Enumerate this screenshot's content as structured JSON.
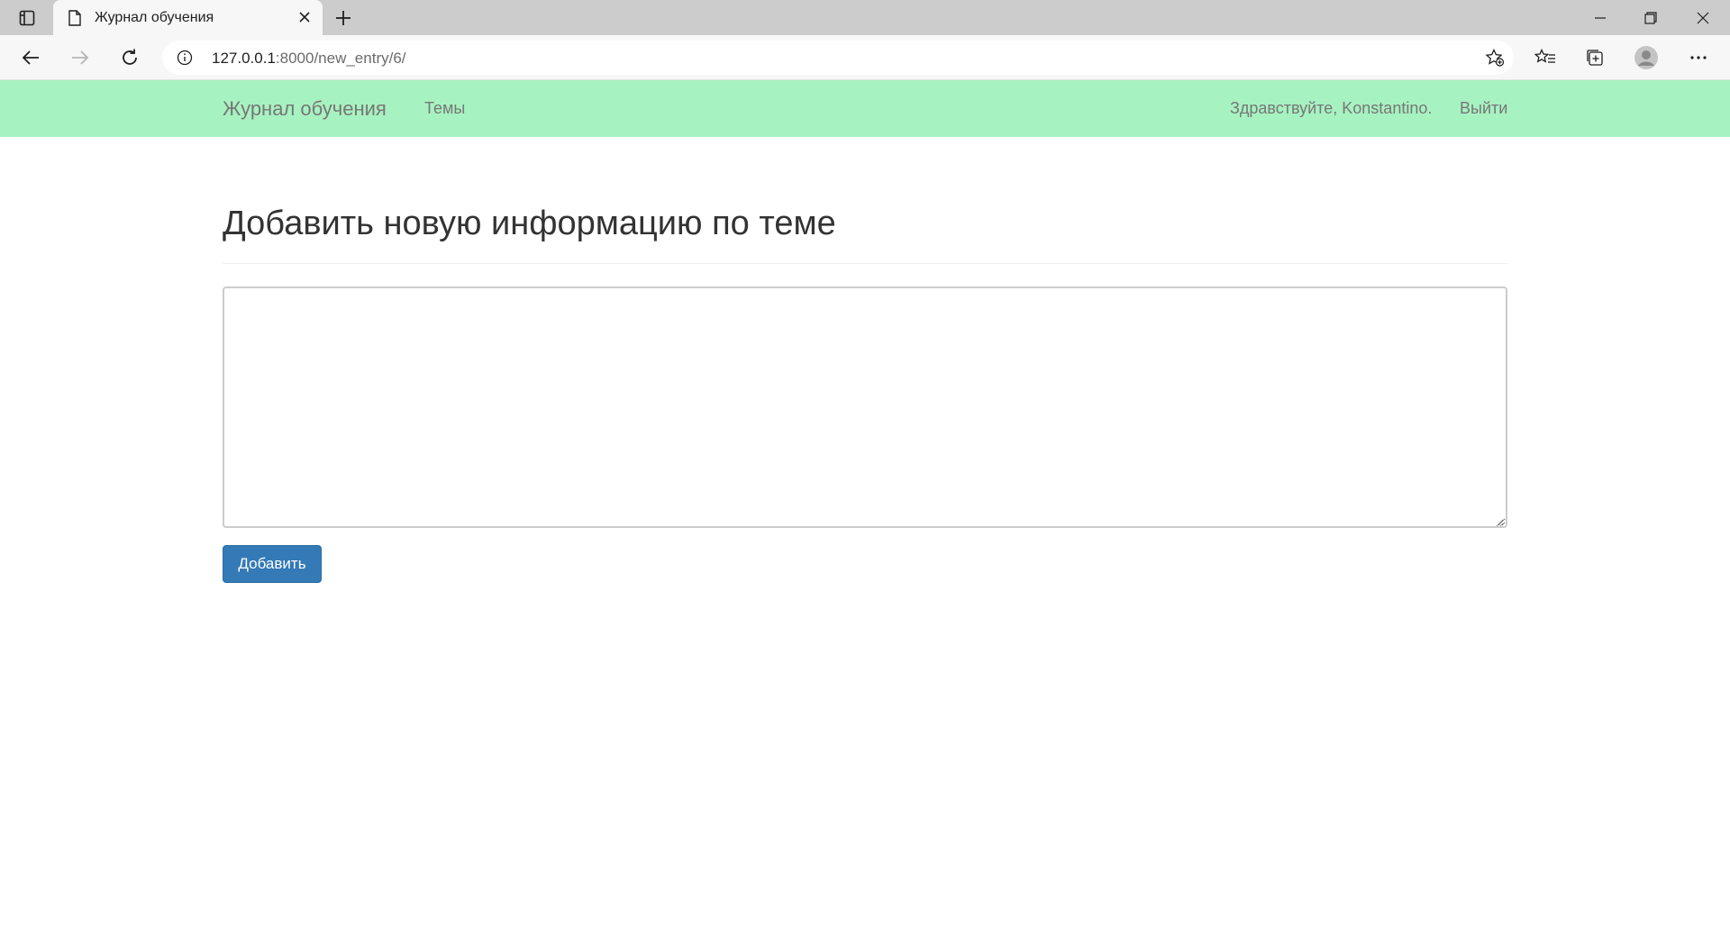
{
  "browser": {
    "tab": {
      "title": "Журнал обучения",
      "favicon": "page-icon"
    },
    "address": {
      "host": "127.0.0.1",
      "path": ":8000/new_entry/6/"
    }
  },
  "navbar": {
    "brand": "Журнал обучения",
    "topics_link": "Темы",
    "greeting": "Здравствуйте, Konstantino.",
    "logout_link": "Выйти",
    "background_color": "#a7f2c1"
  },
  "page": {
    "title": "Добавить новую информацию по теме",
    "entry_text_value": "",
    "submit_label": "Добавить",
    "submit_color": "#337ab7"
  }
}
